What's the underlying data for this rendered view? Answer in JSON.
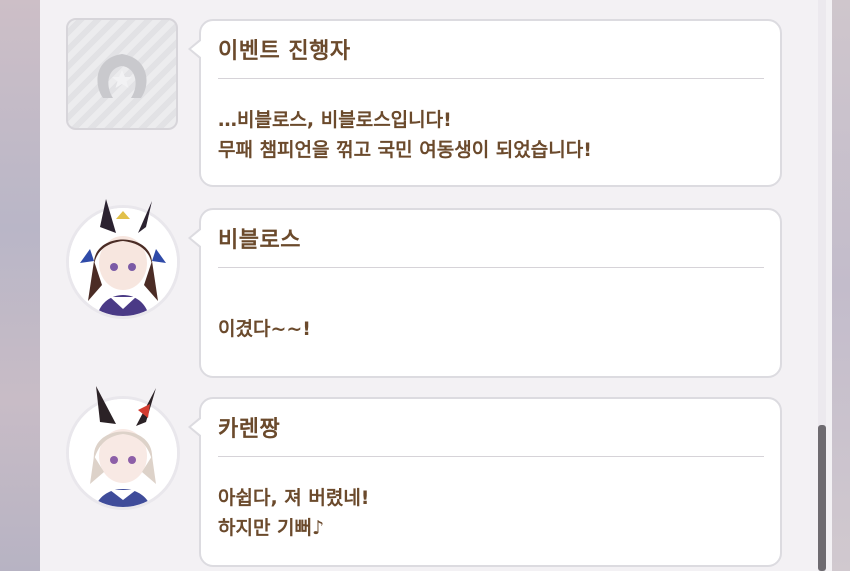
{
  "messages": [
    {
      "speaker": "이벤트 진행자",
      "avatar": "horseshoe-star-placeholder",
      "lines": [
        "…비블로스, 비블로스입니다!",
        "무패 챔피언을 꺾고 국민 여동생이 되었습니다!"
      ]
    },
    {
      "speaker": "비블로스",
      "avatar": "vivlos-portrait",
      "lines": [
        "이겼다~~!"
      ]
    },
    {
      "speaker": "카렌짱",
      "avatar": "curren-chan-portrait",
      "lines": [
        "아쉽다, 져 버렸네!",
        "하지만 기뻐♪"
      ]
    }
  ],
  "colors": {
    "text": "#6b4a2c",
    "bubble_border": "#dcdbe0",
    "panel": "#f3f1f4"
  }
}
